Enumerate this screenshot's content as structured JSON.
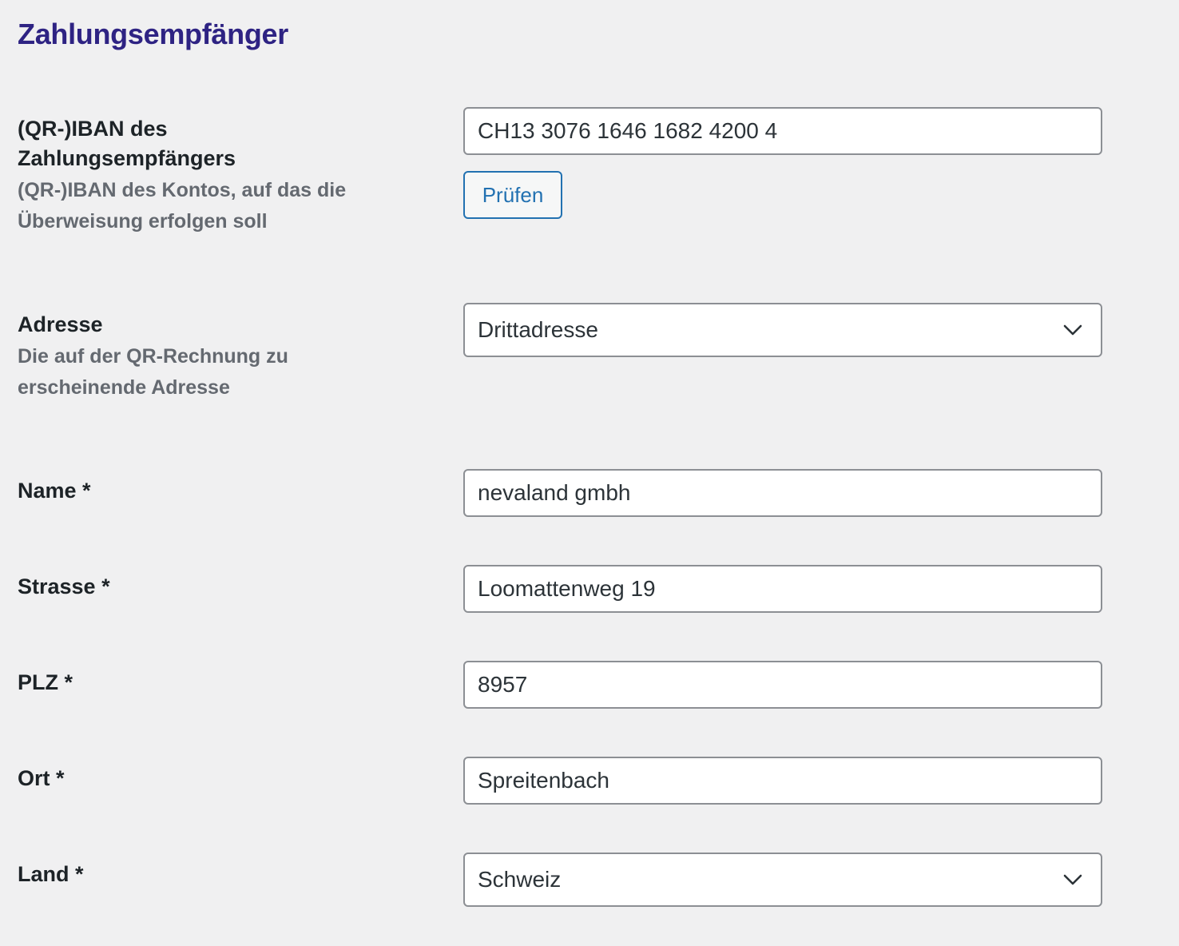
{
  "section": {
    "title": "Zahlungsempfänger"
  },
  "iban": {
    "label_line1": "(QR-)IBAN des",
    "label_line2": "Zahlungsempfängers",
    "desc_line1": "(QR-)IBAN des Kontos, auf das die",
    "desc_line2": "Überweisung erfolgen soll",
    "value": "CH13 3076 1646 1682 4200 4",
    "check_button": "Prüfen"
  },
  "address": {
    "label": "Adresse",
    "desc_line1": "Die auf der QR-Rechnung zu",
    "desc_line2": "erscheinende Adresse",
    "selected": "Drittadresse",
    "icon": "chevron-down-icon"
  },
  "name": {
    "label": "Name *",
    "value": "nevaland gmbh"
  },
  "street": {
    "label": "Strasse *",
    "value": "Loomattenweg 19"
  },
  "zip": {
    "label": "PLZ *",
    "value": "8957"
  },
  "city": {
    "label": "Ort *",
    "value": "Spreitenbach"
  },
  "country": {
    "label": "Land *",
    "selected": "Schweiz",
    "icon": "chevron-down-icon"
  },
  "colors": {
    "title": "#2e2383",
    "link": "#2271b1",
    "background": "#f0f0f1"
  }
}
